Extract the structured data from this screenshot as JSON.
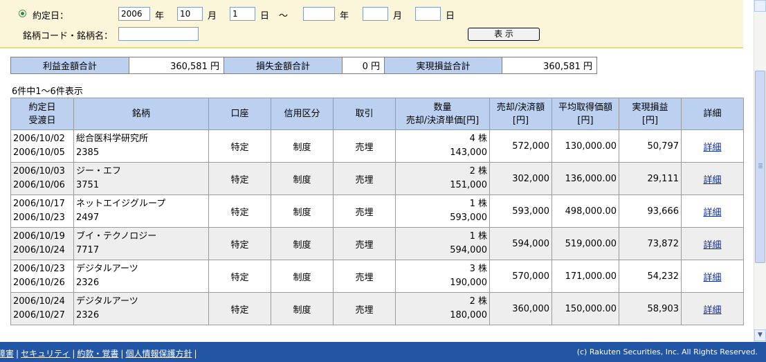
{
  "search": {
    "trade_date_label": "約定日：",
    "from_year": "2006",
    "year_label": "年",
    "from_month": "10",
    "month_label": "月",
    "from_day": "1",
    "day_label": "日",
    "tilde": "～",
    "to_year": "",
    "to_month": "",
    "to_day": "",
    "code_label": "銘柄コード・銘柄名：",
    "code_value": "",
    "show_button": "表 示"
  },
  "summary": {
    "profit_label": "利益金額合計",
    "profit_value": "360,581 円",
    "loss_label": "損失金額合計",
    "loss_value": "0 円",
    "realized_label": "実現損益合計",
    "realized_value": "360,581 円"
  },
  "result_count": "6件中1～6件表示",
  "table": {
    "headers": {
      "date1": "約定日",
      "date2": "受渡日",
      "name": "銘柄",
      "account": "口座",
      "credit": "信用区分",
      "trade": "取引",
      "qty1": "数量",
      "qty2": "売却/決済単価[円]",
      "amount1": "売却/決済額",
      "amount2": "[円]",
      "avg1": "平均取得価額",
      "avg2": "[円]",
      "pnl1": "実現損益",
      "pnl2": "[円]",
      "detail": "詳細"
    },
    "rows": [
      {
        "trade_date": "2006/10/02",
        "settle_date": "2006/10/05",
        "name": "総合医科学研究所",
        "code": "2385",
        "account": "特定",
        "credit": "制度",
        "trade": "売埋",
        "qty": "4 株",
        "price": "143,000",
        "amount": "572,000",
        "avg": "130,000.00",
        "pnl": "50,797",
        "detail": "詳細"
      },
      {
        "trade_date": "2006/10/03",
        "settle_date": "2006/10/06",
        "name": "ジー・エフ",
        "code": "3751",
        "account": "特定",
        "credit": "制度",
        "trade": "売埋",
        "qty": "2 株",
        "price": "151,000",
        "amount": "302,000",
        "avg": "136,000.00",
        "pnl": "29,111",
        "detail": "詳細"
      },
      {
        "trade_date": "2006/10/17",
        "settle_date": "2006/10/23",
        "name": "ネットエイジグループ",
        "code": "2497",
        "account": "特定",
        "credit": "制度",
        "trade": "売埋",
        "qty": "1 株",
        "price": "593,000",
        "amount": "593,000",
        "avg": "498,000.00",
        "pnl": "93,666",
        "detail": "詳細"
      },
      {
        "trade_date": "2006/10/19",
        "settle_date": "2006/10/24",
        "name": "ブイ・テクノロジー",
        "code": "7717",
        "account": "特定",
        "credit": "制度",
        "trade": "売埋",
        "qty": "1 株",
        "price": "594,000",
        "amount": "594,000",
        "avg": "519,000.00",
        "pnl": "73,872",
        "detail": "詳細"
      },
      {
        "trade_date": "2006/10/23",
        "settle_date": "2006/10/26",
        "name": "デジタルアーツ",
        "code": "2326",
        "account": "特定",
        "credit": "制度",
        "trade": "売埋",
        "qty": "3 株",
        "price": "190,000",
        "amount": "570,000",
        "avg": "171,000.00",
        "pnl": "54,232",
        "detail": "詳細"
      },
      {
        "trade_date": "2006/10/24",
        "settle_date": "2006/10/27",
        "name": "デジタルアーツ",
        "code": "2326",
        "account": "特定",
        "credit": "制度",
        "trade": "売埋",
        "qty": "2 株",
        "price": "180,000",
        "amount": "360,000",
        "avg": "150,000.00",
        "pnl": "58,903",
        "detail": "詳細"
      }
    ]
  },
  "footer": {
    "links": [
      "障害",
      "セキュリティ",
      "約款・覚書",
      "個人情報保護方針"
    ],
    "separator": "|",
    "copyright": "(c) Rakuten Securities, Inc. All Rights Reserved."
  },
  "colors": {
    "header_bg": "#bcd0f0",
    "panel_bg": "#fbf5d9",
    "footer_bg": "#2255a4",
    "link": "#0a2a9a"
  }
}
